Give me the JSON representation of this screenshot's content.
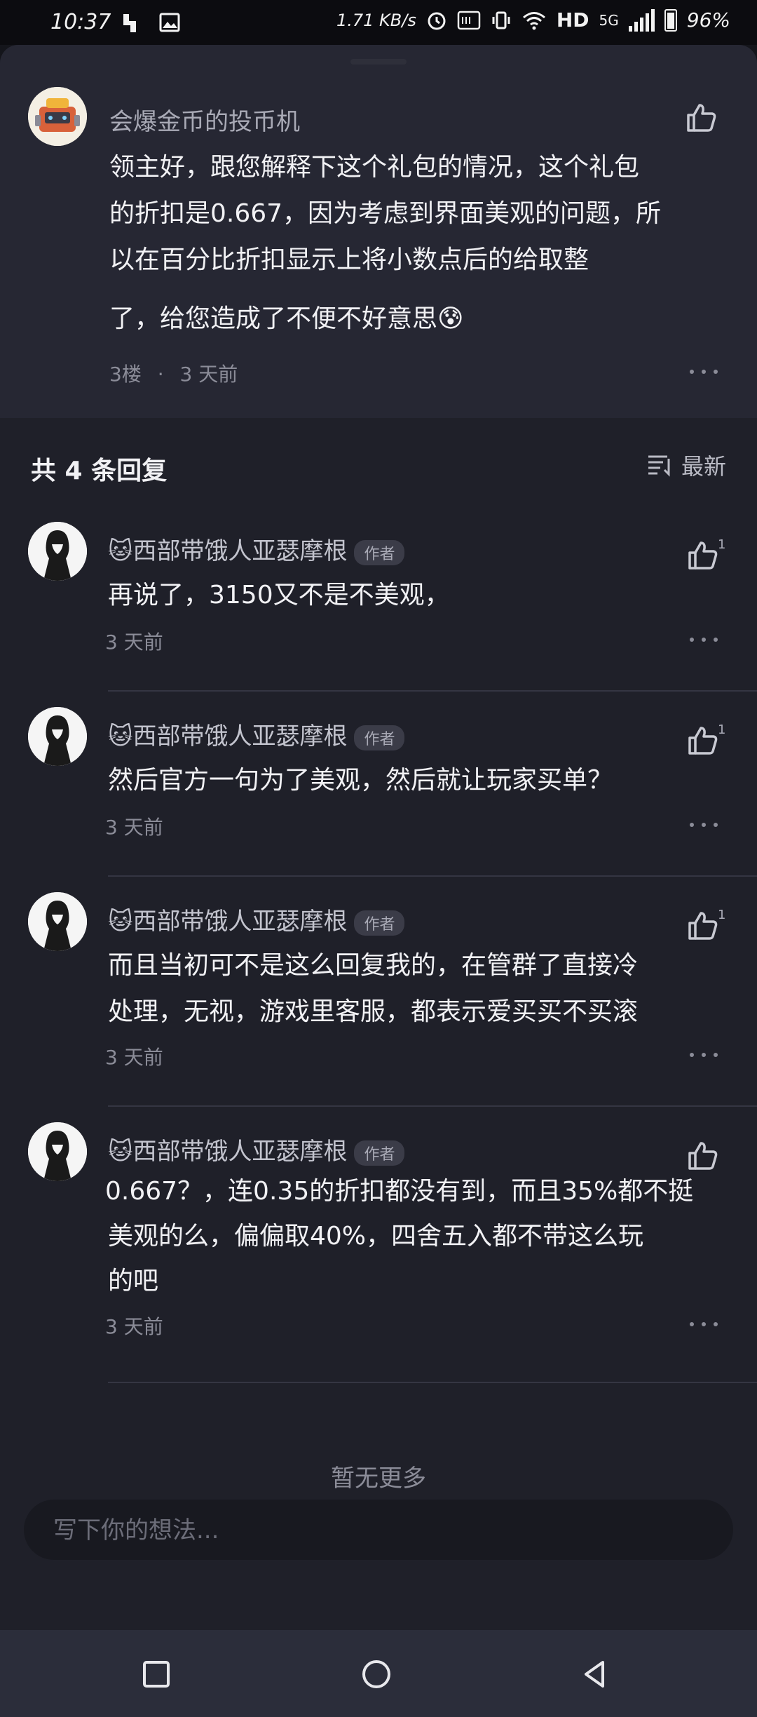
{
  "status_bar": {
    "time": "10:37",
    "net_speed": "1.71 KB/s",
    "network": "HD",
    "signal": "5G",
    "battery": "96%"
  },
  "main_comment": {
    "username": "会爆金币的投币机",
    "text_lines": [
      "领主好，跟您解释下这个礼包的情况，这个礼包",
      "的折扣是0.667，因为考虑到界面美观的问题，所",
      "以在百分比折扣显示上将小数点后的给取整",
      "了，给您造成了不便不好意思😰"
    ],
    "floor": "3楼",
    "time": "3 天前"
  },
  "replies_header": {
    "title": "共 4 条回复",
    "sort_label": "最新"
  },
  "replies": [
    {
      "username": "🐱西部带饿人亚瑟摩根",
      "badge": "作者",
      "text_lines": [
        "再说了，3150又不是不美观，"
      ],
      "time": "3 天前",
      "likes": "1"
    },
    {
      "username": "🐱西部带饿人亚瑟摩根",
      "badge": "作者",
      "text_lines": [
        "然后官方一句为了美观，然后就让玩家买单？"
      ],
      "time": "3 天前",
      "likes": "1"
    },
    {
      "username": "🐱西部带饿人亚瑟摩根",
      "badge": "作者",
      "text_lines": [
        "而且当初可不是这么回复我的，在管群了直接冷",
        "处理，无视，游戏里客服，都表示爱买买不买滚"
      ],
      "time": "3 天前",
      "likes": "1"
    },
    {
      "username": "🐱西部带饿人亚瑟摩根",
      "badge": "作者",
      "text_lines": [
        "0.667？，连0.35的折扣都没有到，而且35%都不挺",
        "美观的么，偏偏取40%，四舍五入都不带这么玩",
        "的吧"
      ],
      "time": "3 天前",
      "likes": ""
    }
  ],
  "no_more": "暂无更多",
  "input": {
    "placeholder": "写下你的想法..."
  },
  "icons": {
    "like": "thumbs-up-icon",
    "more": "more-dots-icon",
    "sort": "sort-lines-icon"
  },
  "colors": {
    "background": "#1f2029",
    "main_comment_bg": "#262733",
    "text": "#f1f1f4",
    "secondary": "#8b8c98"
  }
}
